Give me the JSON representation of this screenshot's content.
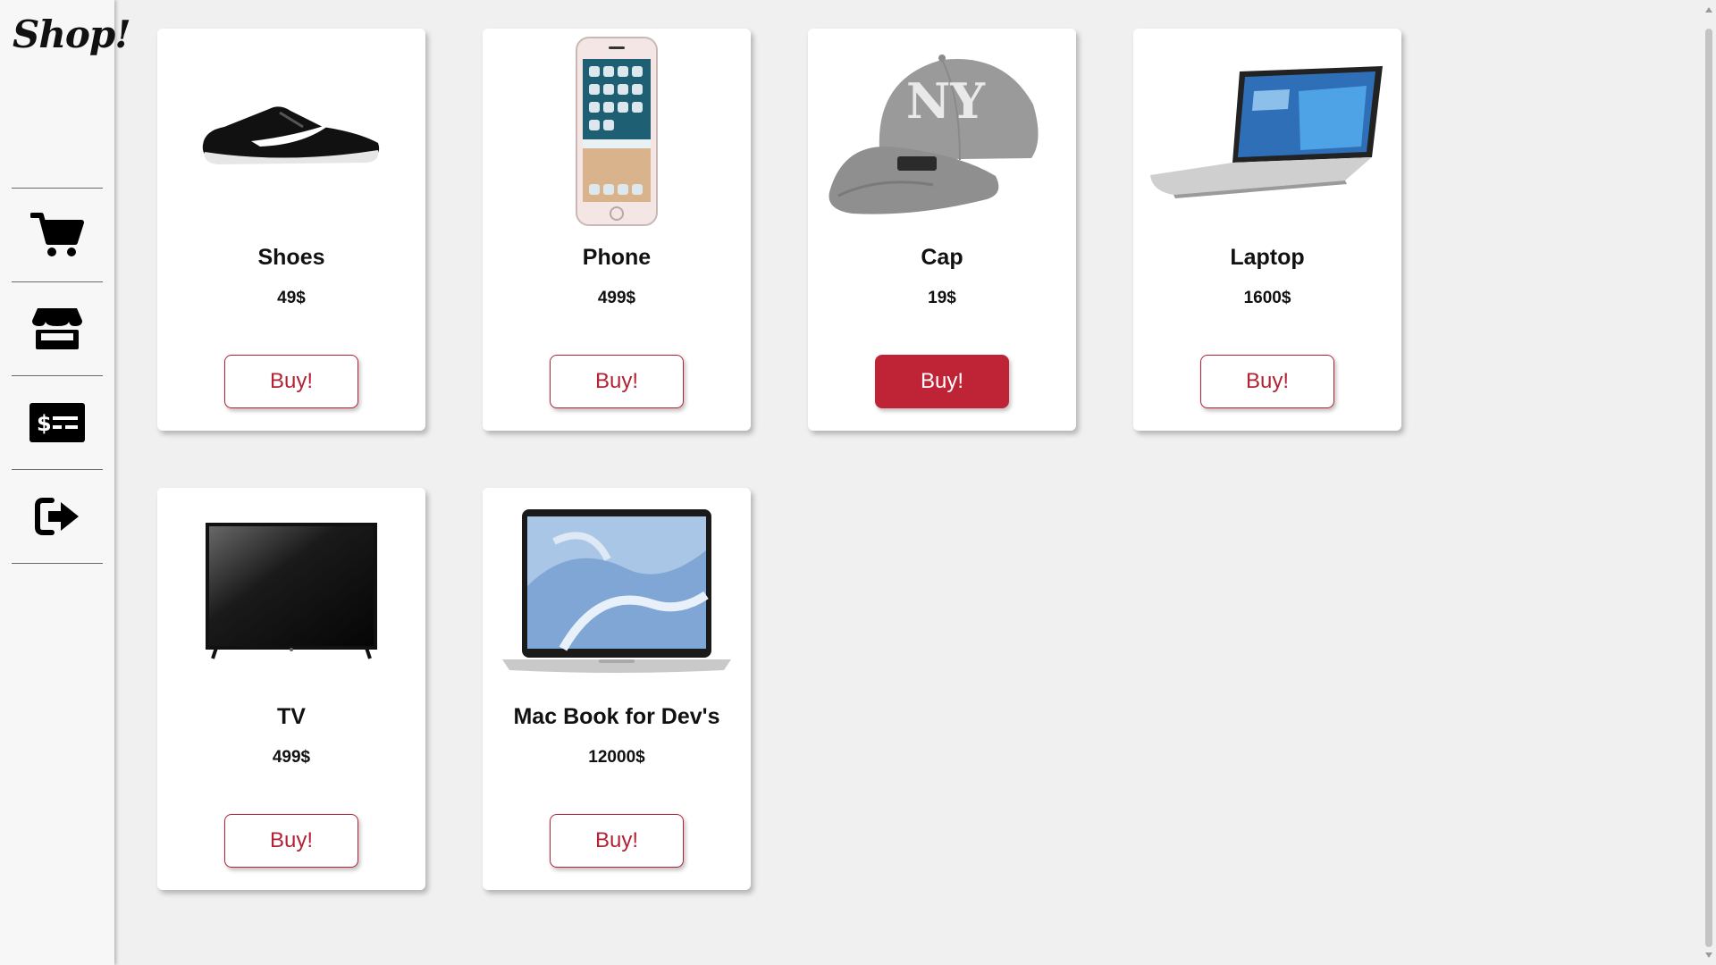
{
  "app": {
    "logo_text": "Shop!"
  },
  "sidebar": {
    "items": [
      {
        "icon": "shopping-cart-icon",
        "label": "cart"
      },
      {
        "icon": "store-icon",
        "label": "store"
      },
      {
        "icon": "money-check-icon",
        "label": "payments"
      },
      {
        "icon": "sign-out-icon",
        "label": "logout"
      }
    ]
  },
  "colors": {
    "accent": "#bf2436",
    "background": "#f0f0f0",
    "card": "#ffffff"
  },
  "products": [
    {
      "name": "Shoes",
      "price": "49$",
      "button_label": "Buy!",
      "image_icon": "sneaker-icon"
    },
    {
      "name": "Phone",
      "price": "499$",
      "button_label": "Buy!",
      "image_icon": "smartphone-icon"
    },
    {
      "name": "Cap",
      "price": "19$",
      "button_label": "Buy!",
      "image_icon": "baseball-cap-icon",
      "hovered": true
    },
    {
      "name": "Laptop",
      "price": "1600$",
      "button_label": "Buy!",
      "image_icon": "laptop-icon"
    },
    {
      "name": "TV",
      "price": "499$",
      "button_label": "Buy!",
      "image_icon": "tv-icon"
    },
    {
      "name": "Mac Book for Dev's",
      "price": "12000$",
      "button_label": "Buy!",
      "image_icon": "macbook-icon"
    }
  ]
}
